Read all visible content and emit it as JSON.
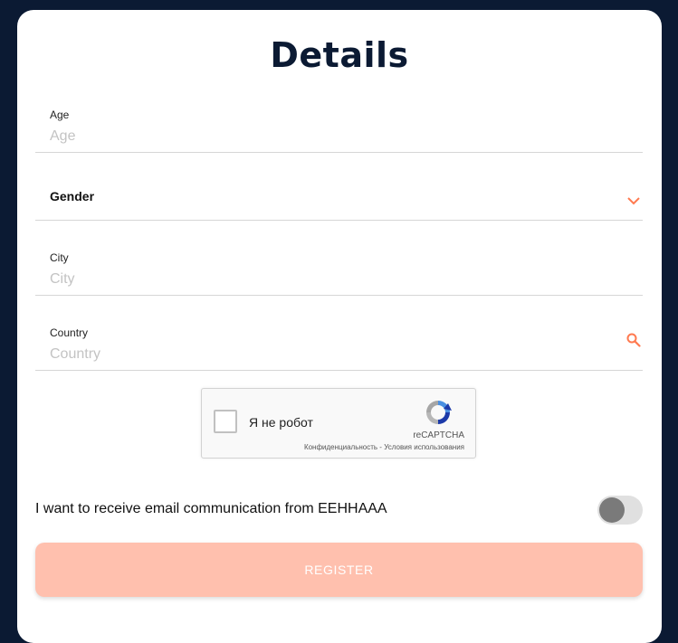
{
  "form": {
    "title": "Details",
    "age": {
      "label": "Age",
      "placeholder": "Age"
    },
    "gender": {
      "label": "Gender"
    },
    "city": {
      "label": "City",
      "placeholder": "City"
    },
    "country": {
      "label": "Country",
      "placeholder": "Country"
    }
  },
  "recaptcha": {
    "checkbox_label": "Я не робот",
    "brand": "reCAPTCHA",
    "terms": "Конфиденциальность - Условия использования"
  },
  "consent": {
    "label": "I want to receive email communication from EEHHAAA",
    "enabled": false
  },
  "register_button": {
    "label": "REGISTER"
  },
  "colors": {
    "accent": "#ff7a50",
    "background": "#0b1a33",
    "button_disabled": "#ffc0ae"
  },
  "icons": {
    "gender": "chevron-down-icon",
    "country": "search-icon",
    "recaptcha": "recaptcha-logo-icon"
  }
}
